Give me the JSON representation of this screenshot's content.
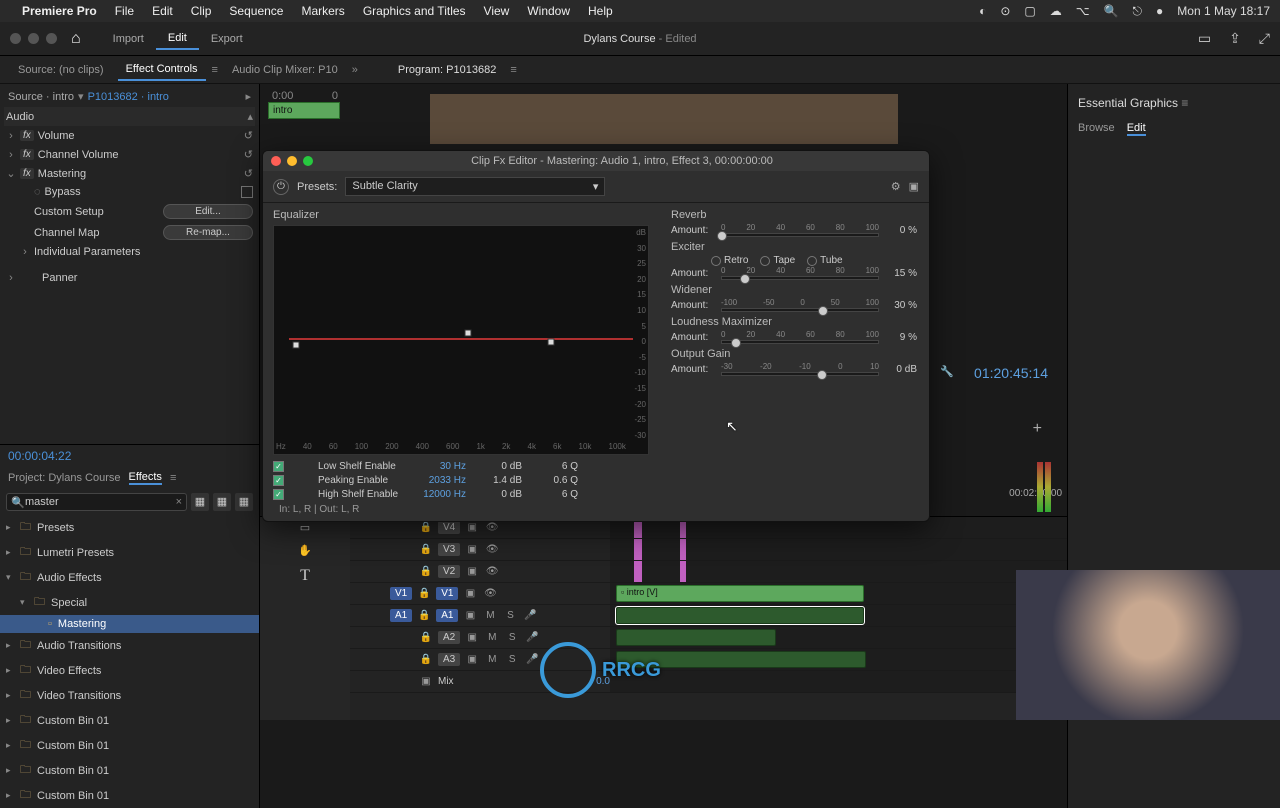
{
  "menubar": {
    "app": "Premiere Pro",
    "items": [
      "File",
      "Edit",
      "Clip",
      "Sequence",
      "Markers",
      "Graphics and Titles",
      "View",
      "Window",
      "Help"
    ],
    "clock": "Mon 1 May 18:17"
  },
  "toolbar": {
    "modes": {
      "import": "Import",
      "edit": "Edit",
      "export": "Export"
    },
    "project_name": "Dylans Course",
    "suffix": " - Edited"
  },
  "source_tabs": {
    "source": "Source: (no clips)",
    "effect_controls": "Effect Controls",
    "audio_mixer": "Audio Clip Mixer: P10",
    "program": "Program: P1013682"
  },
  "effect_controls": {
    "source_line_prefix": "Source · intro",
    "source_line_link": "P1013682 · intro",
    "ruler_start": "0:00",
    "ruler_end": "0",
    "clip_label": "intro",
    "header": "Audio",
    "items": {
      "volume": "Volume",
      "channel_volume": "Channel Volume",
      "mastering": "Mastering",
      "bypass": "Bypass",
      "custom_setup": "Custom Setup",
      "edit_btn": "Edit...",
      "channel_map": "Channel Map",
      "remap_btn": "Re-map...",
      "individual": "Individual Parameters",
      "panner": "Panner"
    }
  },
  "timecode_panel": "00:00:04:22",
  "project_panel": {
    "project_tab": "Project: Dylans Course",
    "effects_tab": "Effects",
    "search": "master",
    "tree": [
      {
        "label": "Presets",
        "lvl": 0
      },
      {
        "label": "Lumetri Presets",
        "lvl": 0
      },
      {
        "label": "Audio Effects",
        "lvl": 0,
        "open": true
      },
      {
        "label": "Special",
        "lvl": 1,
        "open": true
      },
      {
        "label": "Mastering",
        "lvl": 2,
        "sel": true,
        "leaf": true
      },
      {
        "label": "Audio Transitions",
        "lvl": 0
      },
      {
        "label": "Video Effects",
        "lvl": 0
      },
      {
        "label": "Video Transitions",
        "lvl": 0
      },
      {
        "label": "Custom Bin 01",
        "lvl": 0
      },
      {
        "label": "Custom Bin 01",
        "lvl": 0
      },
      {
        "label": "Custom Bin 01",
        "lvl": 0
      },
      {
        "label": "Custom Bin 01",
        "lvl": 0
      }
    ]
  },
  "fx": {
    "title": "Clip Fx Editor - Mastering: Audio 1, intro, Effect 3, 00:00:00:00",
    "presets_label": "Presets:",
    "preset_value": "Subtle Clarity",
    "eq": {
      "title": "Equalizer",
      "y_ticks": [
        "dB",
        "30",
        "25",
        "20",
        "15",
        "10",
        "5",
        "0",
        "-5",
        "-10",
        "-15",
        "-20",
        "-25",
        "-30"
      ],
      "x_ticks": [
        "Hz",
        "40",
        "60",
        "100",
        "200",
        "400",
        "600",
        "1k",
        "2k",
        "4k",
        "6k",
        "10k",
        "100k"
      ],
      "rows": [
        {
          "label": "Low Shelf Enable",
          "hz": "30 Hz",
          "db": "0 dB",
          "q": "6 Q"
        },
        {
          "label": "Peaking Enable",
          "hz": "2033 Hz",
          "db": "1.4 dB",
          "q": "0.6 Q"
        },
        {
          "label": "High Shelf Enable",
          "hz": "12000 Hz",
          "db": "0 dB",
          "q": "6 Q"
        }
      ],
      "io": "In: L, R | Out: L, R"
    },
    "reverb": {
      "title": "Reverb",
      "amount_label": "Amount:",
      "ticks": [
        "0",
        "20",
        "40",
        "60",
        "80",
        "100"
      ],
      "value": "0 %",
      "pos": 0
    },
    "exciter": {
      "title": "Exciter",
      "radios": [
        "Retro",
        "Tape",
        "Tube"
      ],
      "amount_label": "Amount:",
      "ticks": [
        "0",
        "20",
        "40",
        "60",
        "80",
        "100"
      ],
      "value": "15 %",
      "pos": 15
    },
    "widener": {
      "title": "Widener",
      "amount_label": "Amount:",
      "ticks": [
        "-100",
        "-50",
        "0",
        "50",
        "100"
      ],
      "value": "30 %",
      "pos": 65
    },
    "loudness": {
      "title": "Loudness Maximizer",
      "amount_label": "Amount:",
      "ticks": [
        "0",
        "20",
        "40",
        "60",
        "80",
        "100"
      ],
      "value": "9 %",
      "pos": 9
    },
    "gain": {
      "title": "Output Gain",
      "amount_label": "Amount:",
      "ticks": [
        "-30",
        "-20",
        "-10",
        "0",
        "10"
      ],
      "value": "0 dB",
      "pos": 64
    }
  },
  "program": {
    "timecode": "01:20:45:14",
    "duration": "00:02:40:00"
  },
  "timeline": {
    "v_tracks": [
      "V4",
      "V3",
      "V2",
      "V1"
    ],
    "a_tracks": [
      "A1",
      "A2",
      "A3"
    ],
    "mix": "Mix",
    "mix_val": "0.0",
    "v1_src": "V1",
    "a1_src": "A1",
    "intro_clip": "intro [V]"
  },
  "essential_graphics": {
    "title": "Essential Graphics",
    "browse": "Browse",
    "edit": "Edit"
  },
  "watermark": "RRCG"
}
